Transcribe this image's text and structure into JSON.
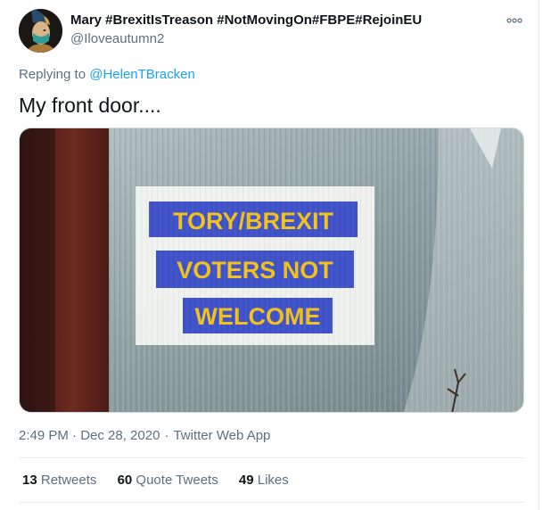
{
  "user": {
    "display_name": "Mary #BrexitIsTreason #NotMovingOn#FBPE#RejoinEU",
    "handle": "@Iloveautumn2"
  },
  "reply": {
    "prefix": "Replying to",
    "to": "@HelenTBracken"
  },
  "tweet": {
    "text": "My front door....",
    "timestamp": "2:49 PM · Dec 28, 2020",
    "source": "Twitter Web App"
  },
  "photo": {
    "sign_lines": [
      "TORY/BREXIT",
      "VOTERS NOT",
      "WELCOME"
    ]
  },
  "stats": [
    {
      "count": "13",
      "label": "Retweets"
    },
    {
      "count": "60",
      "label": "Quote Tweets"
    },
    {
      "count": "49",
      "label": "Likes"
    }
  ],
  "icons": {
    "more": "more-dots-icon"
  },
  "colors": {
    "link": "#1da1f2",
    "muted": "#5b7083",
    "sign_blue": "#3f51c8",
    "sign_yellow": "#f2c21b"
  }
}
